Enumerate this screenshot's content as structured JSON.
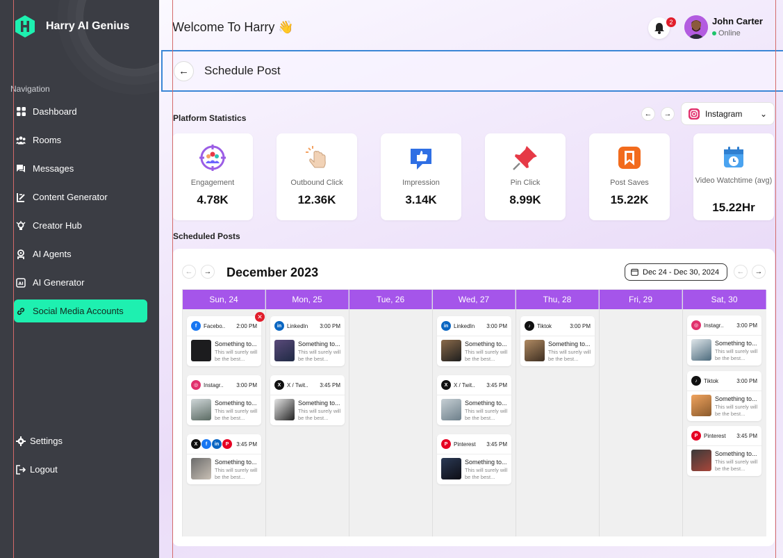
{
  "app": {
    "name": "Harry AI Genius"
  },
  "sidebar": {
    "nav_title": "Navigation",
    "items": [
      {
        "label": "Dashboard",
        "icon": "dashboard-icon"
      },
      {
        "label": "Rooms",
        "icon": "rooms-icon"
      },
      {
        "label": "Messages",
        "icon": "messages-icon"
      },
      {
        "label": "Content Generator",
        "icon": "content-generator-icon"
      },
      {
        "label": "Creator Hub",
        "icon": "creator-hub-icon"
      },
      {
        "label": "AI Agents",
        "icon": "ai-agents-icon"
      },
      {
        "label": "AI Generator",
        "icon": "ai-generator-icon"
      },
      {
        "label": "Social Media Accounts",
        "icon": "link-icon",
        "active": true
      }
    ],
    "bottom": [
      {
        "label": "Settings",
        "icon": "gear-icon"
      },
      {
        "label": "Logout",
        "icon": "logout-icon"
      }
    ]
  },
  "header": {
    "welcome": "Welcome To Harry 👋",
    "notifications": "2",
    "user": {
      "name": "John Carter",
      "status": "Online"
    }
  },
  "page": {
    "title": "Schedule Post"
  },
  "stats": {
    "title": "Platform Statistics",
    "platform": "Instagram",
    "cards": [
      {
        "label": "Engagement",
        "value": "4.78K"
      },
      {
        "label": "Outbound Click",
        "value": "12.36K"
      },
      {
        "label": "Impression",
        "value": "3.14K"
      },
      {
        "label": "Pin Click",
        "value": "8.99K"
      },
      {
        "label": "Post Saves",
        "value": "15.22K"
      },
      {
        "label": "Video Watchtime (avg)",
        "value": "15.22Hr"
      }
    ]
  },
  "scheduled": {
    "title": "Scheduled Posts",
    "month": "December 2023",
    "range": "Dec 24 - Dec 30, 2024",
    "days": [
      "Sun, 24",
      "Mon, 25",
      "Tue, 26",
      "Wed, 27",
      "Thu, 28",
      "Fri, 29",
      "Sat, 30"
    ],
    "post_title": "Something to...",
    "post_desc": "This will surely will be the best...",
    "posts": [
      {
        "day": 0,
        "platform": "Facebo..",
        "time": "2:00 PM"
      },
      {
        "day": 0,
        "platform": "Instagr..",
        "time": "3:00 PM"
      },
      {
        "day": 0,
        "platform": "",
        "time": "3:45 PM"
      },
      {
        "day": 1,
        "platform": "LinkedIn",
        "time": "3:00 PM"
      },
      {
        "day": 1,
        "platform": "X / Twit..",
        "time": "3:45 PM"
      },
      {
        "day": 3,
        "platform": "LinkedIn",
        "time": "3:00 PM"
      },
      {
        "day": 3,
        "platform": "X / Twit..",
        "time": "3:45 PM"
      },
      {
        "day": 3,
        "platform": "Pinterest",
        "time": "3:45 PM"
      },
      {
        "day": 4,
        "platform": "Tiktok",
        "time": "3:00 PM"
      },
      {
        "day": 6,
        "platform": "Instagr..",
        "time": "3:00 PM"
      },
      {
        "day": 6,
        "platform": "Tiktok",
        "time": "3:00 PM"
      },
      {
        "day": 6,
        "platform": "Pinterest",
        "time": "3:45 PM"
      }
    ]
  },
  "colors": {
    "accent": "#a555ea",
    "active_nav": "#1ef0b0",
    "sidebar": "#3b3d44",
    "badge": "#e11d2b"
  }
}
